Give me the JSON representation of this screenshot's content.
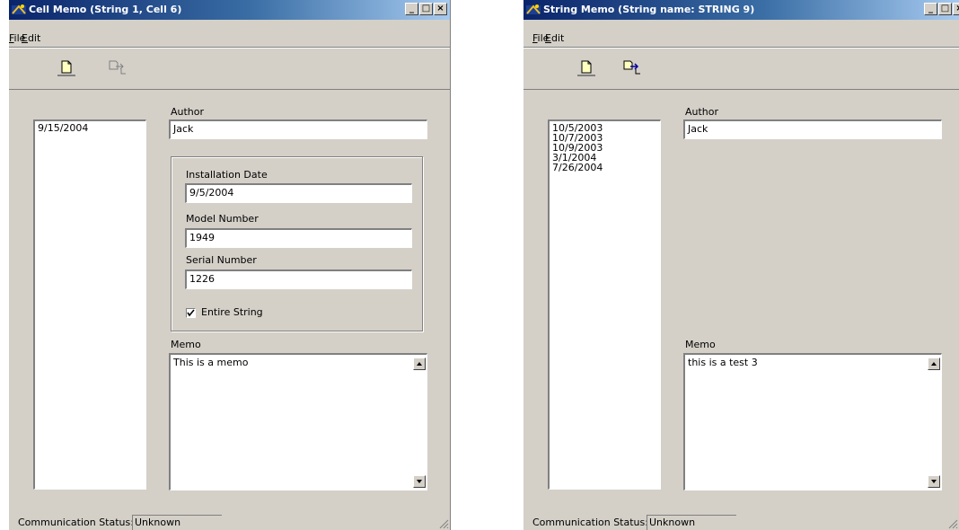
{
  "windows": [
    {
      "title": "Cell Memo (String 1, Cell 6)",
      "menu": [
        "File",
        "Edit"
      ],
      "toolbar_buttons": [
        {
          "icon": "new-document-icon",
          "enabled": true
        },
        {
          "icon": "save-document-icon",
          "enabled": false
        }
      ],
      "dates": [
        "9/15/2004"
      ],
      "author_label": "Author",
      "author_value": "Jack",
      "installation_date_label": "Installation Date",
      "installation_date_value": "9/5/2004",
      "model_number_label": "Model Number",
      "model_number_value": "1949",
      "serial_number_label": "Serial Number",
      "serial_number_value": "1226",
      "entire_string_label": "Entire String",
      "entire_string_checked": true,
      "memo_label": "Memo",
      "memo_value": "This is a memo",
      "status_label": "Communication Status:",
      "status_value": "Unknown"
    },
    {
      "title": "String Memo (String name: STRING 9)",
      "menu": [
        "File",
        "Edit"
      ],
      "toolbar_buttons": [
        {
          "icon": "new-document-icon",
          "enabled": true
        },
        {
          "icon": "save-document-icon",
          "enabled": true
        }
      ],
      "dates": [
        "10/5/2003",
        "10/7/2003",
        "10/9/2003",
        "3/1/2004",
        "7/26/2004"
      ],
      "author_label": "Author",
      "author_value": "Jack",
      "memo_label": "Memo",
      "memo_value": "this is a test 3",
      "status_label": "Communication Status:",
      "status_value": "Unknown"
    }
  ],
  "colors": {
    "titlebar_start": "#0a246a",
    "titlebar_end": "#a6caf0",
    "window_face": "#d4d0c8",
    "field_bg": "#ffffff"
  }
}
